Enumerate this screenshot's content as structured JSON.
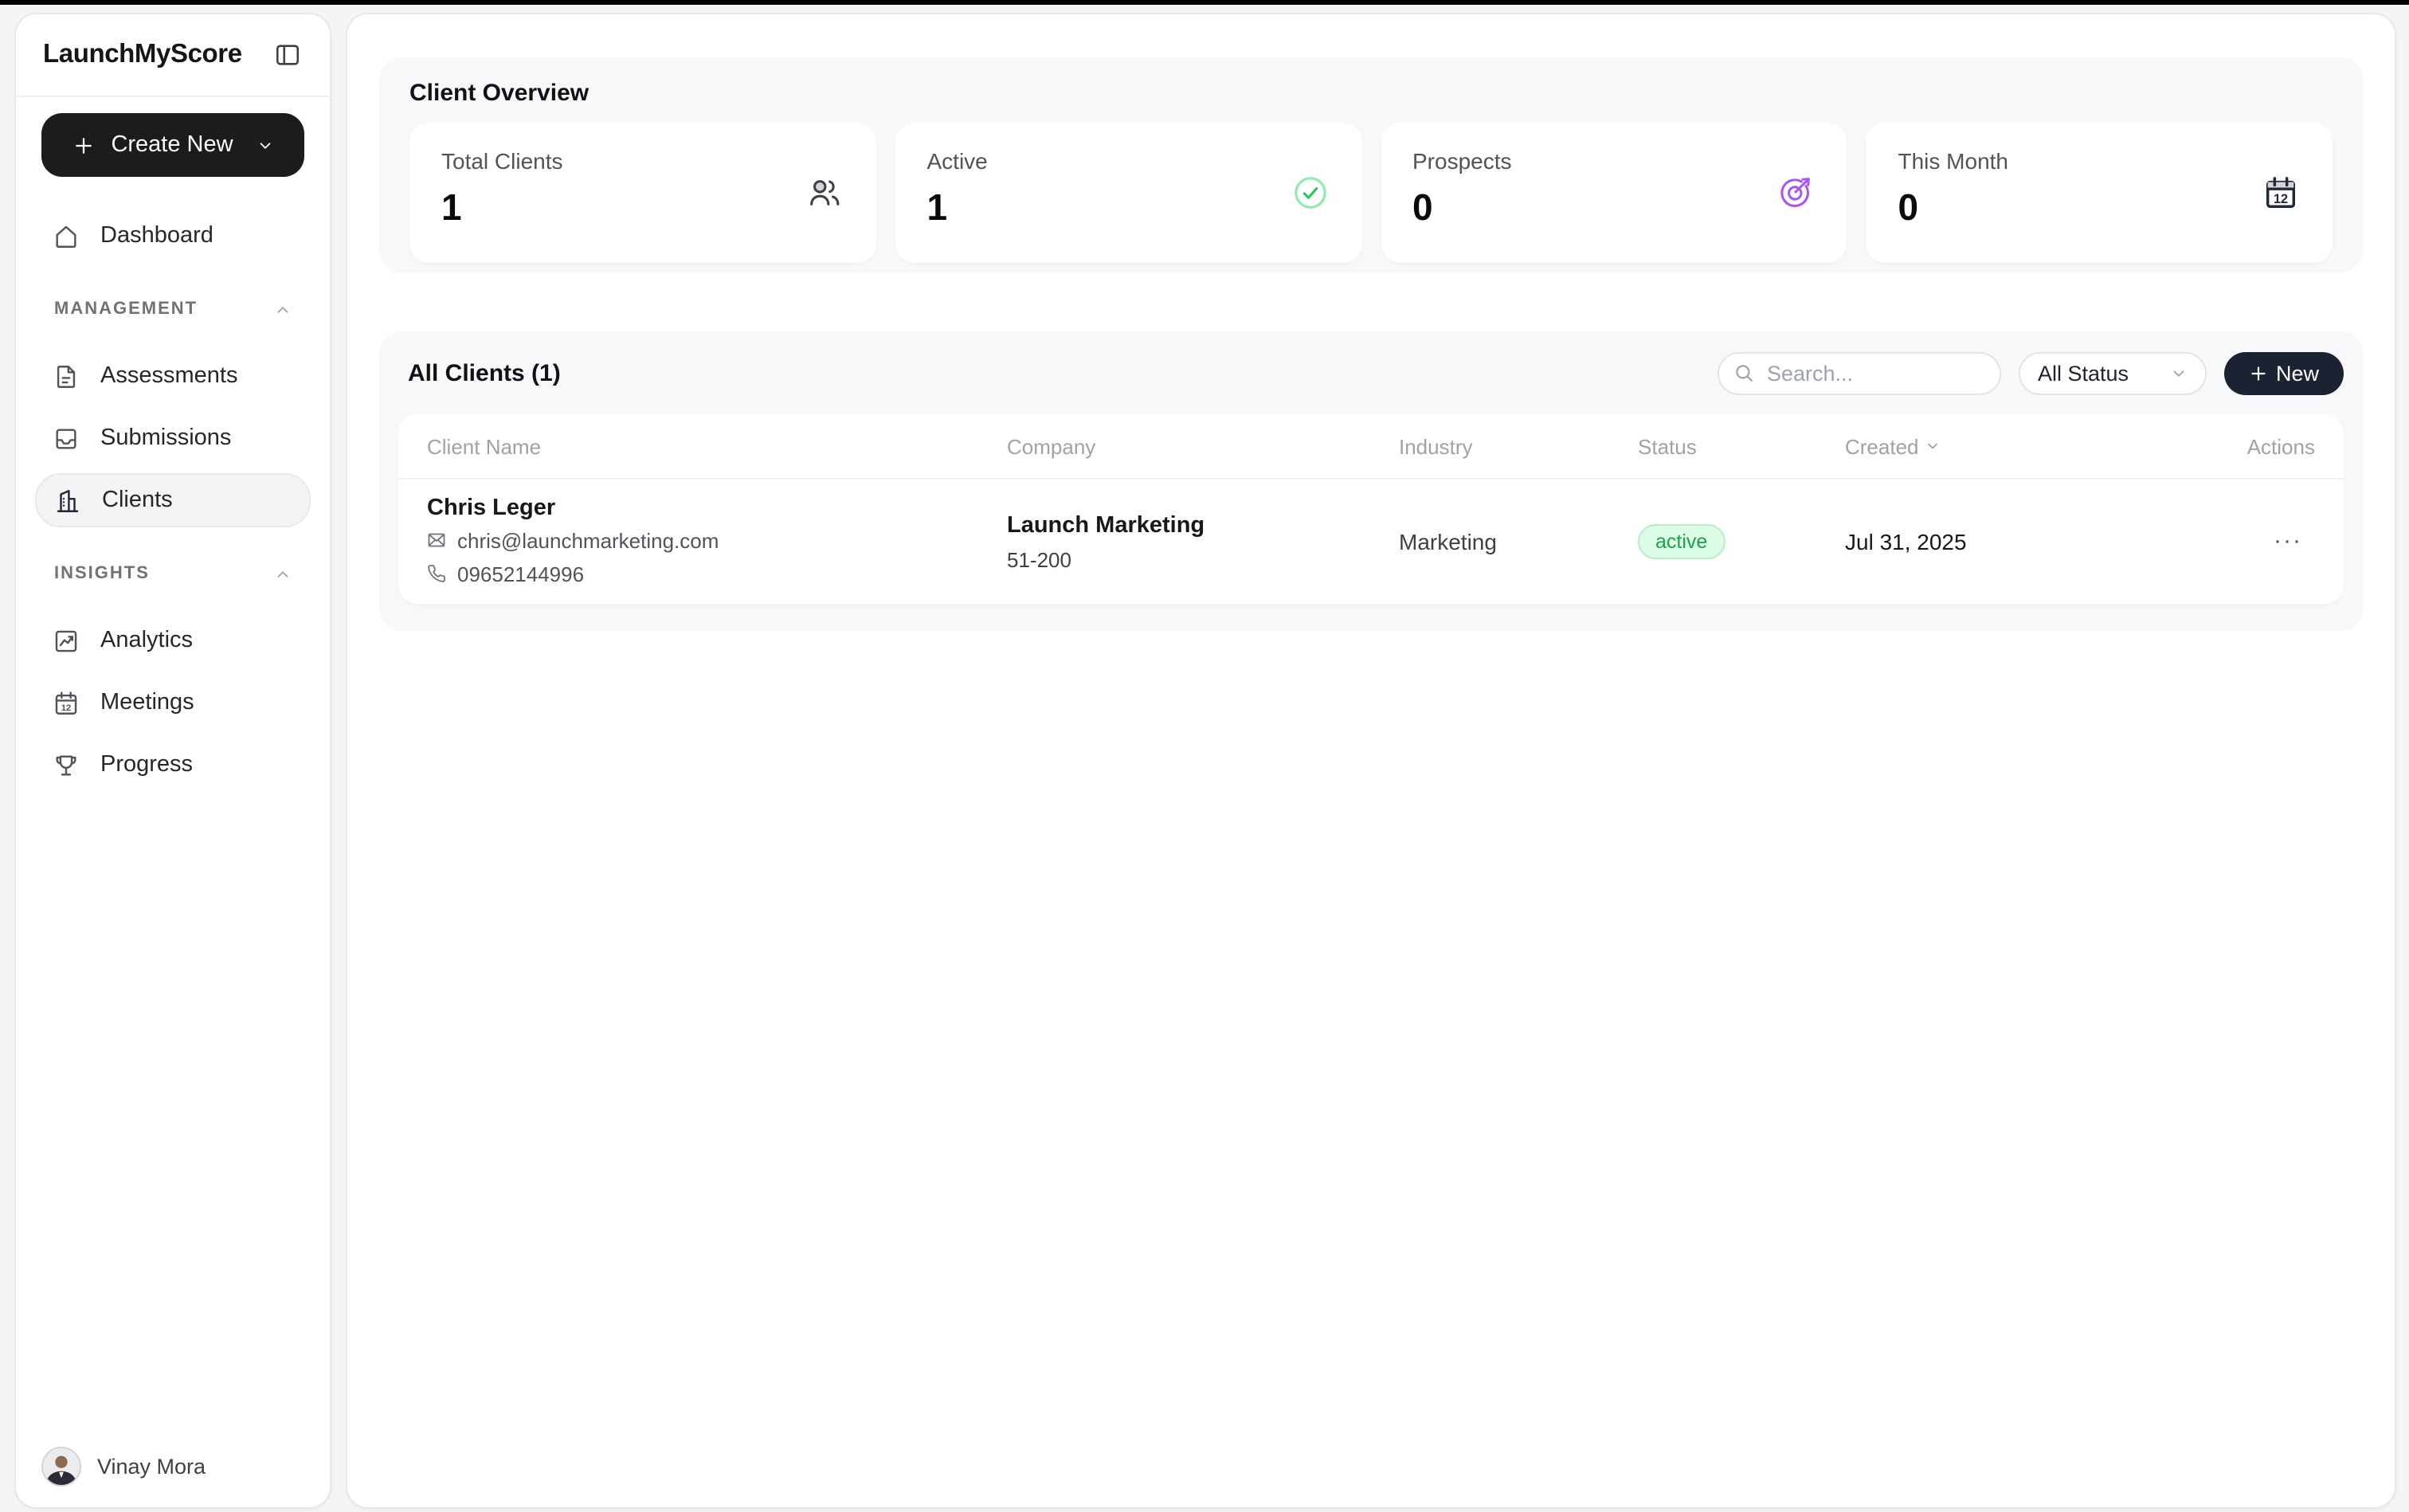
{
  "app": {
    "name": "LaunchMyScore"
  },
  "sidebar": {
    "create_button": {
      "label": "Create New"
    },
    "nav_dashboard": {
      "label": "Dashboard"
    },
    "sections": [
      {
        "label": "MANAGEMENT",
        "items": [
          {
            "label": "Assessments"
          },
          {
            "label": "Submissions"
          },
          {
            "label": "Clients",
            "active": true
          }
        ]
      },
      {
        "label": "INSIGHTS",
        "items": [
          {
            "label": "Analytics"
          },
          {
            "label": "Meetings"
          },
          {
            "label": "Progress"
          }
        ]
      }
    ],
    "user": {
      "name": "Vinay Mora"
    }
  },
  "overview": {
    "title": "Client Overview",
    "stats": [
      {
        "label": "Total Clients",
        "value": "1",
        "icon": "users-icon",
        "icon_color": "#3f3f46"
      },
      {
        "label": "Active",
        "value": "1",
        "icon": "check-circle-icon",
        "icon_color": "#22c55e"
      },
      {
        "label": "Prospects",
        "value": "0",
        "icon": "target-icon",
        "icon_color": "#a855f7"
      },
      {
        "label": "This Month",
        "value": "0",
        "icon": "calendar-icon",
        "icon_color": "#1f2937"
      }
    ]
  },
  "clients": {
    "title": "All Clients (1)",
    "search_placeholder": "Search...",
    "status_filter": "All Status",
    "new_button": "New",
    "columns": [
      "Client Name",
      "Company",
      "Industry",
      "Status",
      "Created",
      "Actions"
    ],
    "rows": [
      {
        "name": "Chris Leger",
        "email": "chris@launchmarketing.com",
        "phone": "09652144996",
        "company": "Launch Marketing",
        "company_size": "51-200",
        "industry": "Marketing",
        "status": "active",
        "created": "Jul 31, 2025"
      }
    ]
  },
  "ui": {
    "ellipsis": "···"
  },
  "colors": {
    "page_bg": "#f5f5f6",
    "panel_bg": "#f7f8f9",
    "create_button_bg": "#1c1c1f",
    "new_button_bg": "#1b2232",
    "badge_bg": "#dcfce7",
    "badge_text": "#16a34a",
    "prospects_accent": "#a855f7",
    "active_accent": "#22c55e"
  }
}
